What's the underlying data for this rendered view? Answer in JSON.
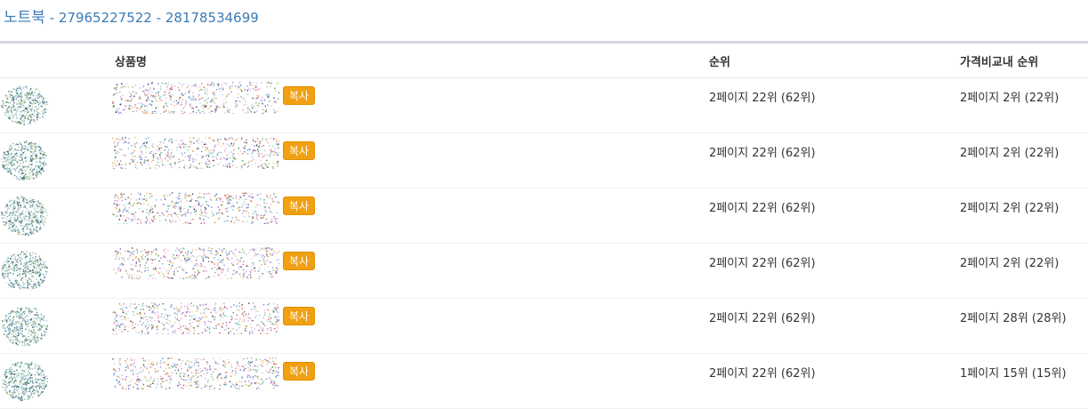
{
  "page": {
    "category": "노트북",
    "separator": " - ",
    "id1": "27965227522",
    "id2": "28178534699"
  },
  "columns": {
    "product_name": "상품명",
    "rank": "순위",
    "price_compare_rank": "가격비교내 순위"
  },
  "rows": [
    {
      "copy": "복사",
      "rank": "2페이지 22위 (62위)",
      "price_rank": "2페이지 2위 (22위)"
    },
    {
      "copy": "복사",
      "rank": "2페이지 22위 (62위)",
      "price_rank": "2페이지 2위 (22위)"
    },
    {
      "copy": "복사",
      "rank": "2페이지 22위 (62위)",
      "price_rank": "2페이지 2위 (22위)"
    },
    {
      "copy": "복사",
      "rank": "2페이지 22위 (62위)",
      "price_rank": "2페이지 2위 (22위)"
    },
    {
      "copy": "복사",
      "rank": "2페이지 22위 (62위)",
      "price_rank": "2페이지 28위 (28위)"
    },
    {
      "copy": "복사",
      "rank": "2페이지 22위 (62위)",
      "price_rank": "1페이지 15위 (15위)"
    }
  ],
  "colors": {
    "title": "#3a7bb6",
    "copy_button": "#f0a010",
    "divider": "#d6d6e2"
  }
}
